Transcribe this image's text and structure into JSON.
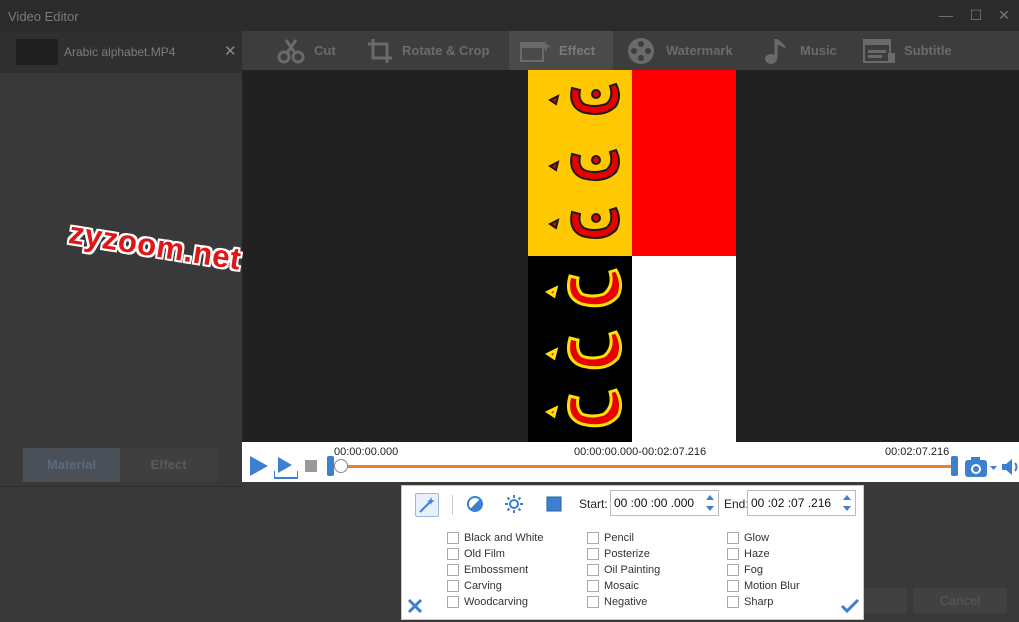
{
  "window": {
    "title": "Video Editor"
  },
  "file": {
    "name": "Arabic alphabet.MP4"
  },
  "left_panel": {
    "material_label": "Material",
    "effect_label": "Effect"
  },
  "tabs": [
    {
      "label": "Cut",
      "icon": "scissors-icon"
    },
    {
      "label": "Rotate & Crop",
      "icon": "crop-icon"
    },
    {
      "label": "Effect",
      "icon": "effect-icon",
      "active": true
    },
    {
      "label": "Watermark",
      "icon": "film-reel-icon"
    },
    {
      "label": "Music",
      "icon": "music-note-icon"
    },
    {
      "label": "Subtitle",
      "icon": "subtitle-icon"
    }
  ],
  "preview": {
    "watermark_text": "zyzoom.net",
    "quadrant_colors": {
      "top_left": "#ffc800",
      "top_right": "#ff0000",
      "bottom_left": "#000000",
      "bottom_right": "#ffffff"
    },
    "glyph_color": "#e80000"
  },
  "player": {
    "start_time": "00:00:00.000",
    "range_time": "00:00:00.000-00:02:07.216",
    "end_time": "00:02:07.216",
    "progress": 0,
    "accent": "#e8822a",
    "handle_color": "#3d7fd0"
  },
  "bottom_buttons": {
    "ok_label": "",
    "cancel_label": "Cancel"
  },
  "effect_popup": {
    "start_label": "Start:",
    "start_value": "00 :00 :00 .000",
    "end_label": "End:",
    "end_value": "00 :02 :07 .216",
    "tools": [
      "magic-wand-icon",
      "contrast-icon",
      "brightness-icon",
      "square-icon"
    ],
    "columns": [
      [
        "Black and White",
        "Old Film",
        "Embossment",
        "Carving",
        "Woodcarving"
      ],
      [
        "Pencil",
        "Posterize",
        "Oil Painting",
        "Mosaic",
        "Negative"
      ],
      [
        "Glow",
        "Haze",
        "Fog",
        "Motion Blur",
        "Sharp"
      ]
    ]
  }
}
